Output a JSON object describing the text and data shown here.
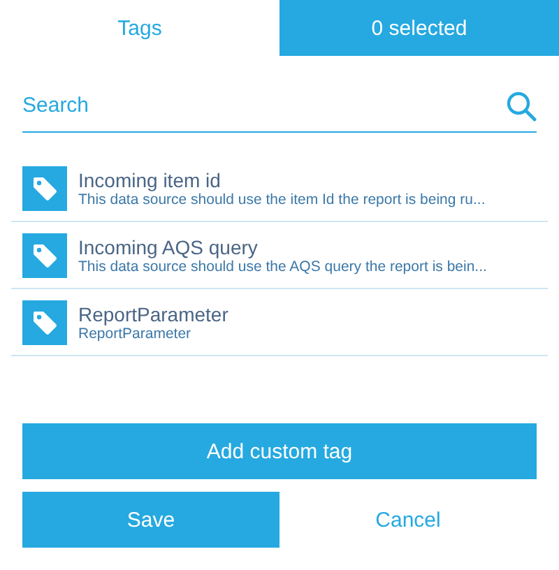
{
  "tabs": [
    {
      "label": "Tags",
      "selected": true
    },
    {
      "label": "0 selected",
      "selected": false
    }
  ],
  "search": {
    "placeholder": "Search"
  },
  "tags": [
    {
      "name": "Incoming item id",
      "description": "This data source should use the item Id the report is being ru..."
    },
    {
      "name": "Incoming AQS query",
      "description": "This data source should use the AQS query the report is bein..."
    },
    {
      "name": "ReportParameter",
      "description": "ReportParameter"
    }
  ],
  "add_button": "Add custom tag",
  "save_button": "Save",
  "cancel_button": "Cancel"
}
